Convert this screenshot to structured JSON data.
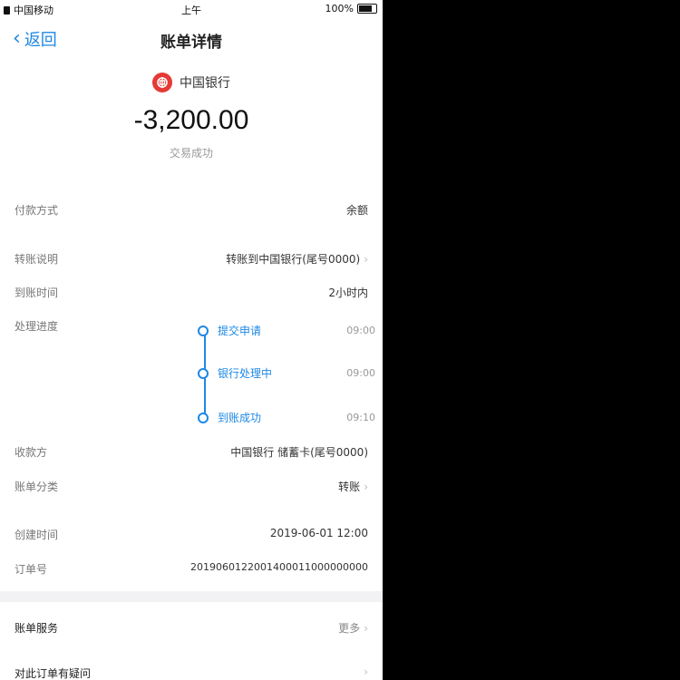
{
  "status_bar": {
    "carrier": "中国移动",
    "time": "上午",
    "battery": "100%"
  },
  "nav": {
    "back_label": "返回",
    "title": "账单详情"
  },
  "merchant": {
    "name": "中国银行"
  },
  "amount": "-3,200.00",
  "status": "交易成功",
  "details": [
    {
      "label": "付款方式",
      "value": "余额"
    },
    {
      "label": "转账说明",
      "value": "转账到中国银行(尾号0000)"
    },
    {
      "label": "到账时间",
      "value": "2小时内"
    }
  ],
  "progress": {
    "label": "处理进度",
    "steps": [
      {
        "label": "提交申请",
        "time": "09:00"
      },
      {
        "label": "银行处理中",
        "time": "09:00"
      },
      {
        "label": "到账成功",
        "time": "09:10"
      }
    ]
  },
  "details2": [
    {
      "label": "收款方",
      "value": "中国银行 储蓄卡(尾号0000)"
    },
    {
      "label": "账单分类",
      "value": "转账",
      "has_arrow": true
    },
    {
      "label": "创建时间",
      "value": "2019-06-01 12:00"
    },
    {
      "label": "订单号",
      "value": "2019060122001400011000000000"
    }
  ],
  "links": [
    {
      "label": "账单服务",
      "value": "更多",
      "has_arrow": true
    },
    {
      "label": "对此订单有疑问",
      "value": "",
      "has_arrow": true
    }
  ],
  "colors": {
    "accent": "#1e88e5",
    "bank_logo": "#e53935",
    "outside_background": "#000000"
  }
}
